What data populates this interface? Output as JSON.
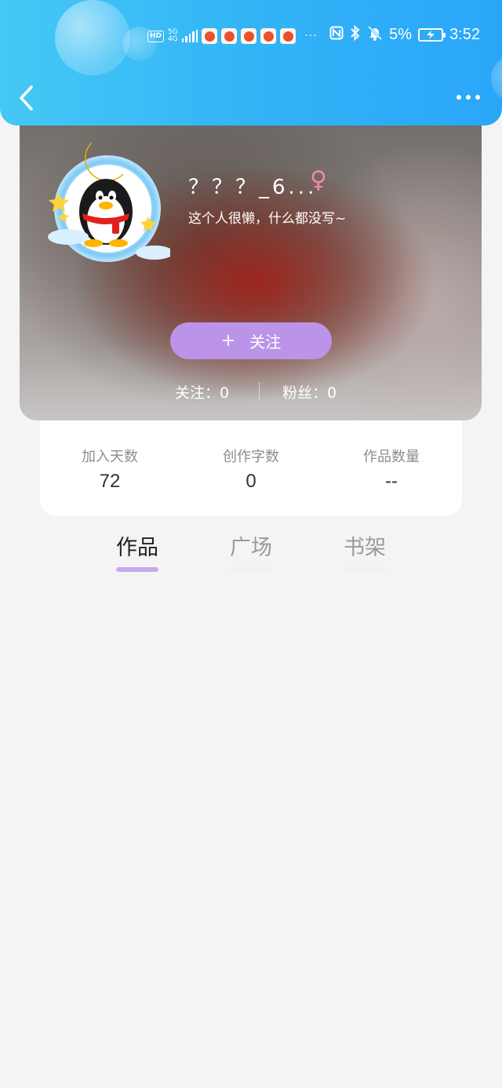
{
  "status_bar": {
    "network_badge": "HD",
    "network_type": "5G",
    "network_sub": "4G",
    "overflow_indicator": "···",
    "battery_percent": "5%",
    "time": "3:52",
    "icons": [
      "hd-icon",
      "signal-icon",
      "app-notification-icon",
      "nfc-icon",
      "bluetooth-icon",
      "mute-bell-icon",
      "battery-charging-icon"
    ]
  },
  "nav": {
    "back_icon": "chevron-left-icon",
    "more_icon": "more-dots-icon"
  },
  "profile": {
    "name": "？？？_6...",
    "gender_symbol": "♀",
    "bio": "这个人很懒，什么都没写~",
    "follow_button": {
      "plus": "+",
      "label": "关注"
    },
    "following_label": "关注：",
    "following_count": "0",
    "fans_label": "粉丝：",
    "fans_count": "0"
  },
  "stats": [
    {
      "label": "加入天数",
      "value": "72"
    },
    {
      "label": "创作字数",
      "value": "0"
    },
    {
      "label": "作品数量",
      "value": "--"
    }
  ],
  "tabs": [
    {
      "label": "作品",
      "active": true
    },
    {
      "label": "广场",
      "active": false
    },
    {
      "label": "书架",
      "active": false
    }
  ],
  "colors": {
    "header_start": "#45c8f5",
    "header_end": "#2aa6f8",
    "follow_button": "#bb94e9",
    "tab_indicator_active": "#c8a9ec",
    "gender_female": "#f08aa0",
    "page_background": "#f4f4f4"
  }
}
